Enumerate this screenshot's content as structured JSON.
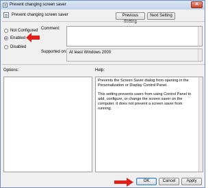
{
  "window": {
    "title": "Prevent changing screen saver",
    "close_label": "✕"
  },
  "header": {
    "setting_name": "Prevent changing screen saver",
    "prev_button": "Previous Setting",
    "next_button": "Next Setting"
  },
  "state_options": {
    "not_configured": "Not Configured",
    "enabled": "Enabled",
    "disabled": "Disabled",
    "selected": "Enabled"
  },
  "labels": {
    "comment": "Comment:",
    "supported_on": "Supported on:",
    "options": "Options:",
    "help": "Help:"
  },
  "supported_value": "At least Windows 2000",
  "help_paragraphs": [
    "Prevents the Screen Saver dialog from opening in the Personalization or Display Control Panel.",
    "This setting prevents users from using Control Panel to add, configure, or change the screen saver on the computer. It does not prevent a screen saver from running."
  ],
  "footer": {
    "ok": "OK",
    "cancel": "Cancel",
    "apply": "Apply"
  },
  "colors": {
    "arrow": "#e0201a",
    "title_bar": "#c4d5ea"
  }
}
